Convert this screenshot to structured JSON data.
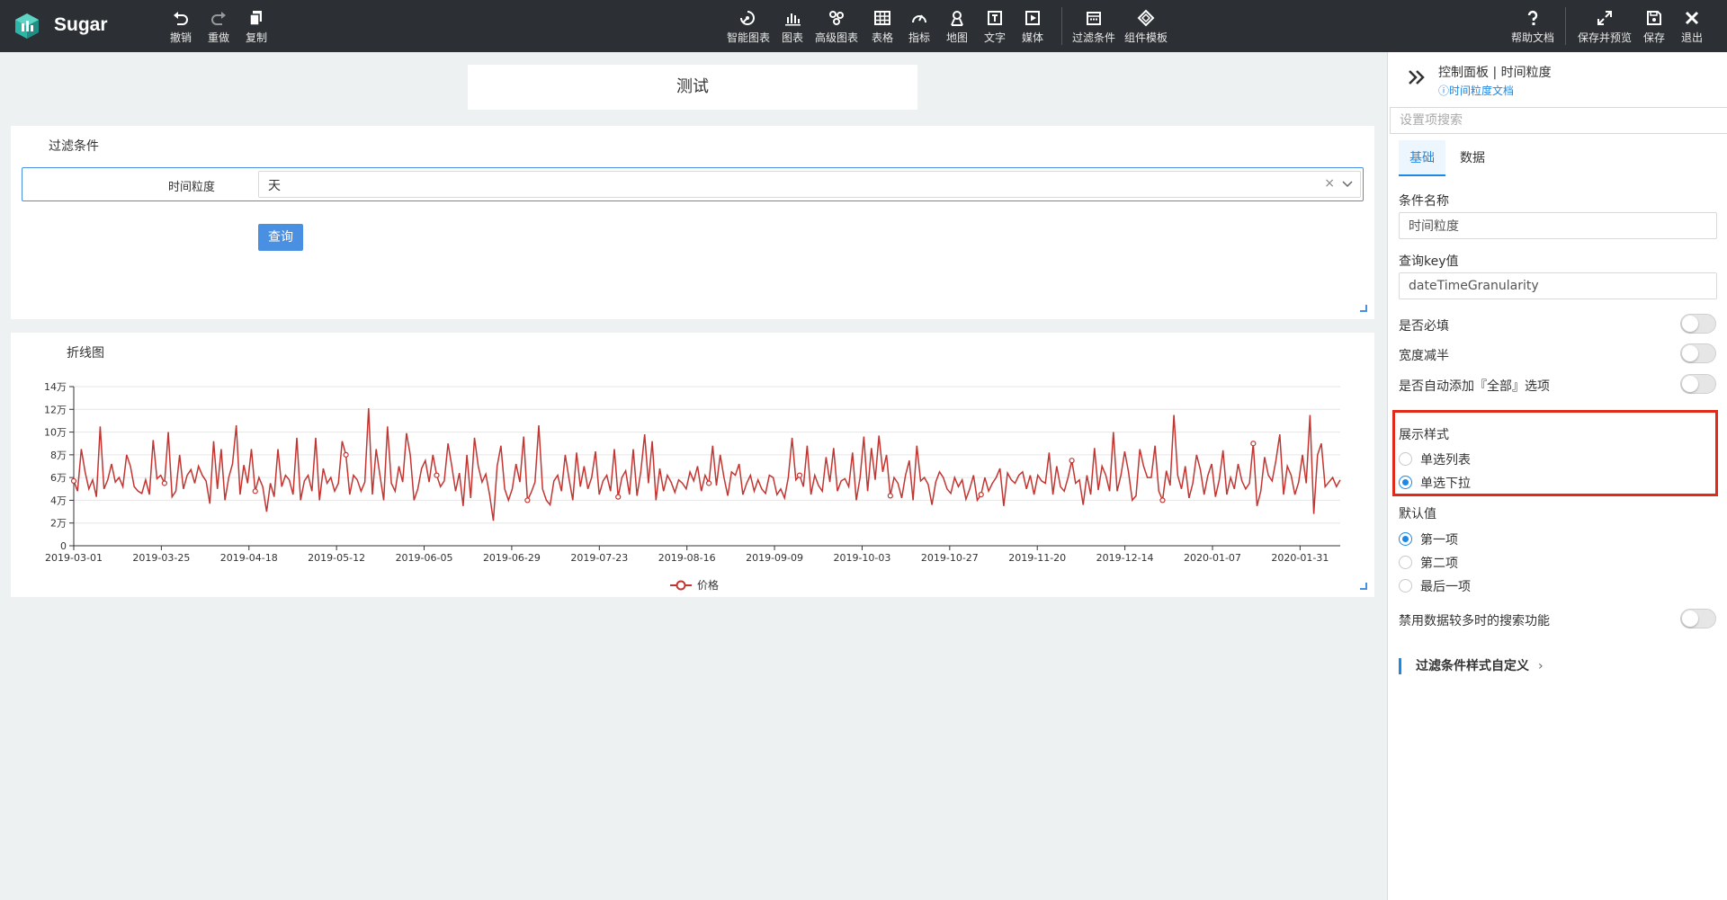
{
  "app": {
    "name": "Sugar"
  },
  "toolbar": {
    "left": [
      {
        "label": "撤销",
        "icon": "undo-icon"
      },
      {
        "label": "重做",
        "icon": "redo-icon"
      },
      {
        "label": "复制",
        "icon": "copy-icon"
      }
    ],
    "center": [
      {
        "label": "智能图表",
        "icon": "smart-chart-icon"
      },
      {
        "label": "图表",
        "icon": "bar-chart-icon"
      },
      {
        "label": "高级图表",
        "icon": "advanced-chart-icon"
      },
      {
        "label": "表格",
        "icon": "table-icon"
      },
      {
        "label": "指标",
        "icon": "gauge-icon"
      },
      {
        "label": "地图",
        "icon": "map-pin-icon"
      },
      {
        "label": "文字",
        "icon": "text-icon"
      },
      {
        "label": "媒体",
        "icon": "media-icon"
      },
      {
        "label": "过滤条件",
        "icon": "filter-calendar-icon"
      },
      {
        "label": "组件模板",
        "icon": "template-icon"
      }
    ],
    "right": [
      {
        "label": "帮助文档",
        "icon": "help-icon"
      },
      {
        "label": "保存并预览",
        "icon": "expand-icon"
      },
      {
        "label": "保存",
        "icon": "save-icon"
      },
      {
        "label": "退出",
        "icon": "close-icon"
      }
    ]
  },
  "page": {
    "title": "测试"
  },
  "filter_card": {
    "title": "过滤条件",
    "field_label": "时间粒度",
    "field_value": "天",
    "clear_symbol": "×",
    "query_label": "查询"
  },
  "chart_card": {
    "title": "折线图"
  },
  "chart_data": {
    "type": "line",
    "title": "",
    "xlabel": "",
    "ylabel": "",
    "ylim": [
      0,
      140000
    ],
    "y_tick_labels": [
      "0",
      "2万",
      "4万",
      "6万",
      "8万",
      "10万",
      "12万",
      "14万"
    ],
    "y_tick_values": [
      0,
      20000,
      40000,
      60000,
      80000,
      100000,
      120000,
      140000
    ],
    "x_tick_labels": [
      "2019-03-01",
      "2019-03-25",
      "2019-04-18",
      "2019-05-12",
      "2019-06-05",
      "2019-06-29",
      "2019-07-23",
      "2019-08-16",
      "2019-09-09",
      "2019-10-03",
      "2019-10-27",
      "2019-11-20",
      "2019-12-14",
      "2020-01-07",
      "2020-01-31"
    ],
    "x_start": "2019-03-01",
    "x_end": "2020-02-11",
    "grid": true,
    "legend_position": "bottom",
    "color": "#c23531",
    "series": [
      {
        "name": "价格",
        "values": [
          57000,
          48000,
          85000,
          65000,
          50000,
          58000,
          43000,
          105000,
          50000,
          58000,
          72000,
          56000,
          60000,
          52000,
          80000,
          70000,
          52000,
          48000,
          46000,
          58000,
          45000,
          93000,
          59000,
          62000,
          55000,
          100000,
          43000,
          48000,
          80000,
          50000,
          62000,
          67000,
          55000,
          70000,
          62000,
          57000,
          37000,
          92000,
          50000,
          85000,
          40000,
          60000,
          72000,
          106000,
          45000,
          71000,
          55000,
          85000,
          48000,
          60000,
          52000,
          30000,
          55000,
          43000,
          85000,
          52000,
          62000,
          58000,
          45000,
          95000,
          40000,
          57000,
          62000,
          48000,
          95000,
          40000,
          68000,
          55000,
          60000,
          48000,
          55000,
          92000,
          80000,
          45000,
          62000,
          58000,
          48000,
          56000,
          121000,
          45000,
          85000,
          62000,
          40000,
          105000,
          55000,
          48000,
          70000,
          56000,
          99000,
          80000,
          40000,
          50000,
          68000,
          75000,
          56000,
          80000,
          62000,
          52000,
          57000,
          90000,
          70000,
          48000,
          64000,
          35000,
          80000,
          42000,
          95000,
          70000,
          56000,
          63000,
          45000,
          22000,
          70000,
          88000,
          50000,
          40000,
          50000,
          72000,
          56000,
          96000,
          40000,
          47000,
          56000,
          106000,
          50000,
          40000,
          36000,
          57000,
          62000,
          48000,
          80000,
          59000,
          40000,
          82000,
          52000,
          70000,
          50000,
          60000,
          83000,
          45000,
          57000,
          62000,
          48000,
          85000,
          43000,
          60000,
          66000,
          45000,
          85000,
          44000,
          65000,
          98000,
          55000,
          92000,
          40000,
          68000,
          48000,
          62000,
          56000,
          47000,
          58000,
          55000,
          50000,
          65000,
          57000,
          70000,
          48000,
          62000,
          55000,
          88000,
          53000,
          80000,
          60000,
          44000,
          65000,
          62000,
          72000,
          45000,
          55000,
          62000,
          48000,
          58000,
          50000,
          46000,
          62000,
          60000,
          45000,
          50000,
          42000,
          60000,
          95000,
          58000,
          62000,
          52000,
          88000,
          45000,
          62000,
          53000,
          48000,
          78000,
          56000,
          86000,
          48000,
          57000,
          59000,
          52000,
          82000,
          40000,
          60000,
          96000,
          48000,
          86000,
          58000,
          97000,
          65000,
          80000,
          44000,
          60000,
          55000,
          42000,
          62000,
          75000,
          40000,
          88000,
          57000,
          60000,
          54000,
          36000,
          56000,
          65000,
          60000,
          50000,
          46000,
          60000,
          52000,
          58000,
          41000,
          50000,
          62000,
          40000,
          45000,
          60000,
          48000,
          55000,
          60000,
          68000,
          35000,
          64000,
          58000,
          55000,
          62000,
          65000,
          50000,
          62000,
          45000,
          62000,
          57000,
          55000,
          82000,
          45000,
          70000,
          52000,
          48000,
          60000,
          75000,
          55000,
          58000,
          36000,
          62000,
          45000,
          86000,
          49000,
          70000,
          62000,
          48000,
          100000,
          48000,
          62000,
          83000,
          65000,
          40000,
          44000,
          85000,
          70000,
          60000,
          60000,
          88000,
          48000,
          40000,
          66000,
          53000,
          115000,
          62000,
          50000,
          70000,
          42000,
          55000,
          80000,
          67000,
          45000,
          62000,
          72000,
          43000,
          58000,
          84000,
          45000,
          60000,
          50000,
          72000,
          57000,
          50000,
          55000,
          90000,
          35000,
          48000,
          78000,
          62000,
          57000,
          75000,
          98000,
          45000,
          70000,
          62000,
          45000,
          56000,
          80000,
          55000,
          115000,
          28000,
          80000,
          90000,
          52000,
          56000,
          60000,
          52000,
          58000
        ]
      }
    ]
  },
  "panel": {
    "header_title": "控制面板 | 时间粒度",
    "doc_link": "ⓘ时间粒度文档",
    "search_placeholder": "设置项搜索",
    "tabs": [
      {
        "label": "基础",
        "active": true
      },
      {
        "label": "数据",
        "active": false
      }
    ],
    "condition_name_label": "条件名称",
    "condition_name_value": "时间粒度",
    "query_key_label": "查询key值",
    "query_key_value": "dateTimeGranularity",
    "switches": [
      {
        "label": "是否必填",
        "on": false
      },
      {
        "label": "宽度减半",
        "on": false
      },
      {
        "label": "是否自动添加『全部』选项",
        "on": false
      }
    ],
    "display_style_label": "展示样式",
    "display_style_options": [
      {
        "label": "单选列表",
        "checked": false
      },
      {
        "label": "单选下拉",
        "checked": true
      }
    ],
    "default_value_label": "默认值",
    "default_value_options": [
      {
        "label": "第一项",
        "checked": true
      },
      {
        "label": "第二项",
        "checked": false
      },
      {
        "label": "最后一项",
        "checked": false
      }
    ],
    "disable_search_label": "禁用数据较多时的搜索功能",
    "disable_search_on": false,
    "custom_style_label": "过滤条件样式自定义",
    "custom_style_chevron": "›",
    "accent_color": "#1e88e5",
    "highlight_color": "#e02a1a"
  }
}
